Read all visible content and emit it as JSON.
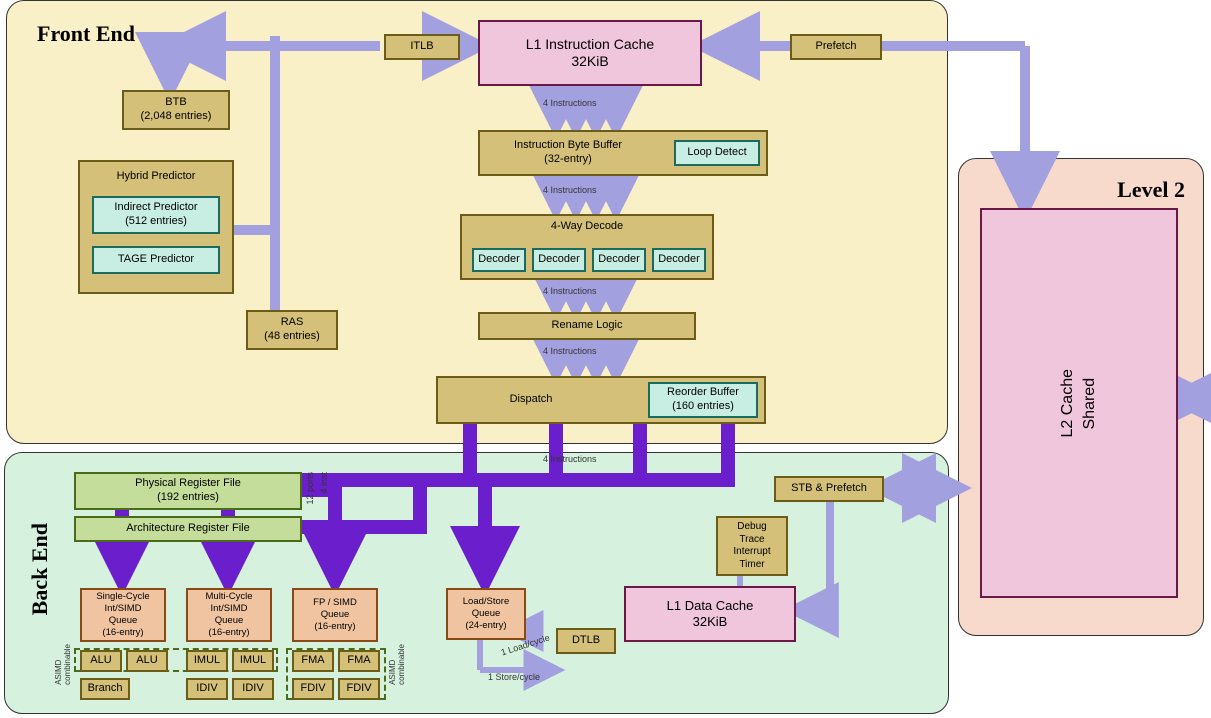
{
  "regions": {
    "frontend": "Front End",
    "backend": "Back End",
    "level2": "Level 2"
  },
  "frontend": {
    "itlb": "ITLB",
    "l1i": {
      "line1": "L1 Instruction Cache",
      "line2": "32KiB"
    },
    "prefetch": "Prefetch",
    "btb": {
      "line1": "BTB",
      "line2": "(2,048 entries)"
    },
    "hybrid": {
      "title": "Hybrid Predictor"
    },
    "indirect": {
      "line1": "Indirect Predictor",
      "line2": "(512 entries)"
    },
    "tage": "TAGE Predictor",
    "ras": {
      "line1": "RAS",
      "line2": "(48 entries)"
    },
    "ibb": {
      "line1": "Instruction Byte Buffer",
      "line2": "(32-entry)"
    },
    "loopdetect": "Loop Detect",
    "decode_title": "4-Way Decode",
    "decoder": "Decoder",
    "rename": "Rename Logic",
    "dispatch": "Dispatch",
    "rob": {
      "line1": "Reorder Buffer",
      "line2": "(160 entries)"
    },
    "lbl_4instr": "4 Instructions"
  },
  "backend": {
    "prf": {
      "line1": "Physical Register File",
      "line2": "(192 entries)"
    },
    "arf": "Architecture Register File",
    "lbl_12ports": "12 ports",
    "lbl_4inst": "4 inst",
    "stb": "STB & Prefetch",
    "debug": {
      "l1": "Debug",
      "l2": "Trace",
      "l3": "Interrupt",
      "l4": "Timer"
    },
    "l1d": {
      "line1": "L1 Data Cache",
      "line2": "32KiB"
    },
    "dtlb": "DTLB",
    "single": {
      "l1": "Single-Cycle",
      "l2": "Int/SIMD",
      "l3": "Queue",
      "l4": "(16-entry)"
    },
    "multi": {
      "l1": "Multi-Cycle",
      "l2": "Int/SIMD",
      "l3": "Queue",
      "l4": "(16-entry)"
    },
    "fp": {
      "l1": "FP / SIMD",
      "l2": "Queue",
      "l3": "(16-entry)"
    },
    "ls": {
      "l1": "Load/Store",
      "l2": "Queue",
      "l3": "(24-entry)"
    },
    "alu": "ALU",
    "imul": "IMUL",
    "idiv": "IDIV",
    "fma": "FMA",
    "fdiv": "FDIV",
    "branch": "Branch",
    "asimd": "ASIMD\ncombinable",
    "load1": "1 Load/cycle",
    "store1": "1 Store/cycle"
  },
  "level2": {
    "l2cache": {
      "line1": "L2 Cache",
      "line2": "Shared"
    }
  }
}
